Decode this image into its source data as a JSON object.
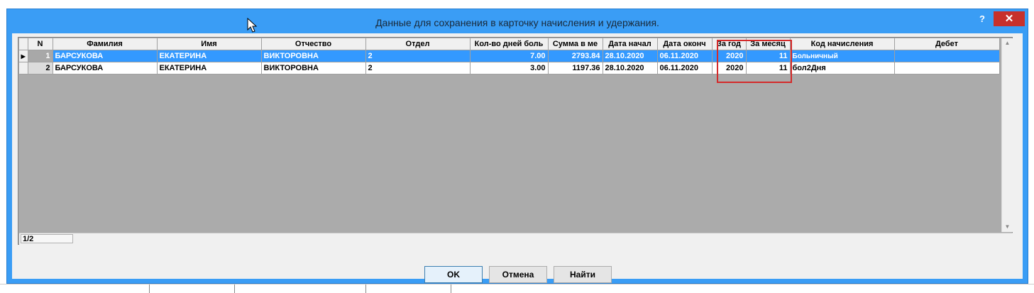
{
  "dialog": {
    "title": "Данные для сохранения в карточку начисления и удержания.",
    "help_label": "?",
    "close_label": "✕"
  },
  "grid": {
    "columns": [
      "N",
      "Фамилия",
      "Имя",
      "Отчество",
      "Отдел",
      "Кол-во дней боль",
      "Сумма в ме",
      "Дата начал",
      "Дата оконч",
      "За год",
      "За месяц",
      "Код начисления",
      "Дебет"
    ],
    "rows": [
      {
        "n": "1",
        "surname": "БАРСУКОВА",
        "name": "ЕКАТЕРИНА",
        "patronymic": "ВИКТОРОВНА",
        "dept": "2",
        "days": "7.00",
        "sum": "2793.84",
        "date_start": "28.10.2020",
        "date_end": "06.11.2020",
        "year": "2020",
        "month": "11",
        "code": "Больничный",
        "debit": ""
      },
      {
        "n": "2",
        "surname": "БАРСУКОВА",
        "name": "ЕКАТЕРИНА",
        "patronymic": "ВИКТОРОВНА",
        "dept": "2",
        "days": "3.00",
        "sum": "1197.36",
        "date_start": "28.10.2020",
        "date_end": "06.11.2020",
        "year": "2020",
        "month": "11",
        "code": "бол2Дня",
        "debit": ""
      }
    ],
    "selected_row": 1,
    "record_indicator": "1/2"
  },
  "buttons": {
    "ok": "OK",
    "cancel": "Отмена",
    "find": "Найти"
  },
  "colors": {
    "title_bar": "#3a9df5",
    "selection": "#3399ff",
    "close": "#c7302b",
    "highlight": "#d42a2a"
  }
}
